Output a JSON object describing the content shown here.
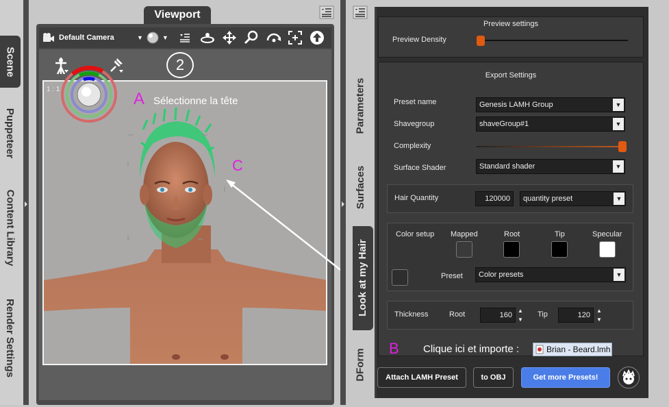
{
  "left_tabs": [
    {
      "label": "Scene",
      "active": true
    },
    {
      "label": "Puppeteer",
      "active": false
    },
    {
      "label": "Content Library",
      "active": false
    },
    {
      "label": "Render Settings",
      "active": false
    }
  ],
  "viewport": {
    "tab_label": "Viewport",
    "camera": "Default Camera",
    "toolbar_icons": [
      "camera-icon",
      "shading-sphere-icon",
      "menu-icon",
      "orbit-icon",
      "pan-icon",
      "zoom-icon",
      "rotate-icon",
      "frame-icon",
      "home-icon"
    ],
    "marker_number": "2",
    "zoom_label": "1 : 1"
  },
  "annotations": {
    "a_letter": "A",
    "a_text": "Sélectionne la tête",
    "b_letter": "B",
    "b_text": "Clique ici et importe :",
    "c_letter": "C",
    "file_chip": "Brian - Beard.lmh",
    "accent": "#e020e0"
  },
  "right_tabs": [
    {
      "label": "Parameters",
      "active": false
    },
    {
      "label": "Surfaces",
      "active": false
    },
    {
      "label": "Look at my Hair",
      "active": true
    },
    {
      "label": "DForm",
      "active": false
    }
  ],
  "preview": {
    "title": "Preview settings",
    "density_label": "Preview Density",
    "density_value": 0.0
  },
  "export": {
    "title": "Export Settings",
    "preset_name_label": "Preset name",
    "preset_name": "Genesis LAMH Group",
    "shavegroup_label": "Shavegroup",
    "shavegroup": "shaveGroup#1",
    "complexity_label": "Complexity",
    "complexity_value": 1.0,
    "shader_label": "Surface Shader",
    "shader": "Standard shader"
  },
  "hair_quantity": {
    "label": "Hair Quantity",
    "value": "120000",
    "preset": "quantity preset"
  },
  "color_setup": {
    "label": "Color setup",
    "mapped_label": "Mapped",
    "root_label": "Root",
    "tip_label": "Tip",
    "specular_label": "Specular",
    "preset_label": "Preset",
    "preset": "Color presets",
    "colors": {
      "mapped": "#3a3a3a",
      "root": "#000000",
      "tip": "#000000",
      "specular": "#ffffff",
      "extra": "#2e2e2e"
    }
  },
  "thickness": {
    "label": "Thickness",
    "root_label": "Root",
    "root_value": "160",
    "tip_label": "Tip",
    "tip_value": "120"
  },
  "buttons": {
    "attach": "Attach LAMH Preset",
    "to_obj": "to OBJ",
    "get_more": "Get more Presets!"
  },
  "colors": {
    "slider_handle": "#e05a10",
    "get_more_bg": "#4a7de8"
  }
}
